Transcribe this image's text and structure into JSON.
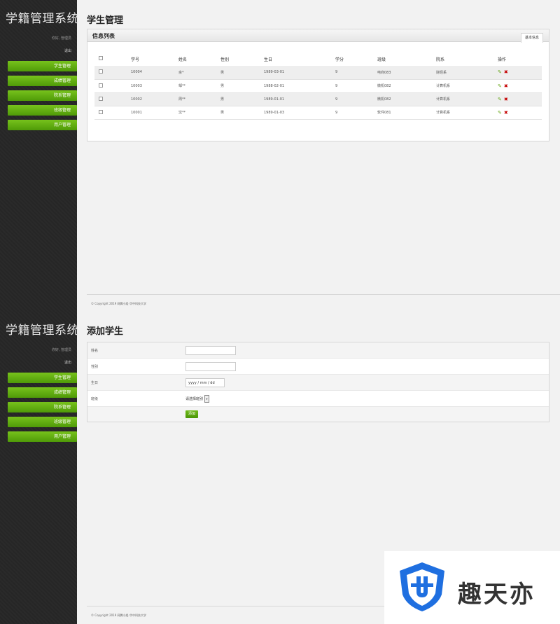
{
  "sidebar": {
    "brand": "学籍管理系统",
    "greeting": "你好, 管理员",
    "logout": "退出",
    "items": [
      {
        "label": "学生管理"
      },
      {
        "label": "成绩管理"
      },
      {
        "label": "院系管理"
      },
      {
        "label": "班级管理"
      },
      {
        "label": "用户管理"
      }
    ]
  },
  "list_page": {
    "title": "学生管理",
    "panel_title": "信息列表",
    "panel_tab": "基本信息",
    "columns": [
      "学号",
      "姓名",
      "性别",
      "生日",
      "学分",
      "班级",
      "院系",
      "操作"
    ],
    "rows": [
      {
        "id": "10004",
        "name": "余*",
        "gender": "男",
        "birthday": "1989-03-01",
        "credits": "9",
        "class": "电商083",
        "dept": "财经系"
      },
      {
        "id": "10003",
        "name": "邹**",
        "gender": "男",
        "birthday": "1988-02-01",
        "credits": "9",
        "class": "微机082",
        "dept": "计算机系"
      },
      {
        "id": "10002",
        "name": "周**",
        "gender": "男",
        "birthday": "1989-01-01",
        "credits": "9",
        "class": "微机082",
        "dept": "计算机系"
      },
      {
        "id": "10001",
        "name": "沈**",
        "gender": "男",
        "birthday": "1989-01-03",
        "credits": "9",
        "class": "软件081",
        "dept": "计算机系"
      }
    ]
  },
  "add_page": {
    "title": "添加学生",
    "fields": {
      "name_label": "姓名",
      "gender_label": "性别",
      "birthday_label": "生日",
      "birthday_placeholder": "yyyy / mm / dd",
      "class_label": "班级",
      "class_select": "请选择班别"
    },
    "submit_label": "添加"
  },
  "footer": "© Copyright 2019 网腾小组-华中科技大学",
  "watermark": "趣天亦",
  "colors": {
    "accent": "#5faa10",
    "sidebar": "#282828",
    "delete": "#c40000"
  }
}
